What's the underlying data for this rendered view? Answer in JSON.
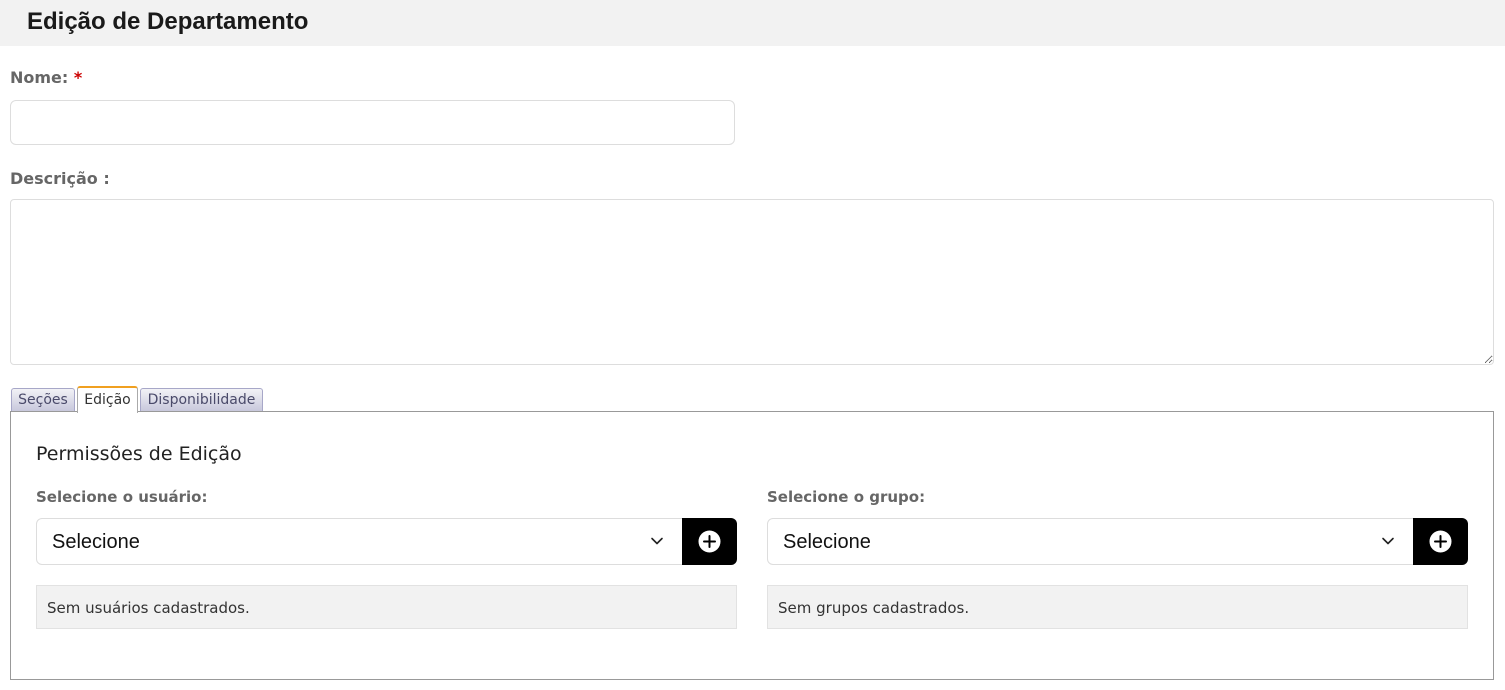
{
  "header": {
    "title": "Edição de Departamento"
  },
  "form": {
    "name_label": "Nome:",
    "name_required": "*",
    "name_value": "",
    "description_label": "Descrição :",
    "description_value": ""
  },
  "tabs": [
    {
      "label": "Seções",
      "active": false
    },
    {
      "label": "Edição",
      "active": true
    },
    {
      "label": "Disponibilidade",
      "active": false
    }
  ],
  "panel": {
    "title": "Permissões de Edição",
    "user": {
      "label": "Selecione o usuário:",
      "selected": "Selecione",
      "empty_message": "Sem usuários cadastrados."
    },
    "group": {
      "label": "Selecione o grupo:",
      "selected": "Selecione",
      "empty_message": "Sem grupos cadastrados."
    }
  },
  "colors": {
    "header_bg": "#f2f2f2",
    "required": "#cc0000",
    "active_tab_accent": "#f0a020",
    "add_button_bg": "#000000"
  }
}
